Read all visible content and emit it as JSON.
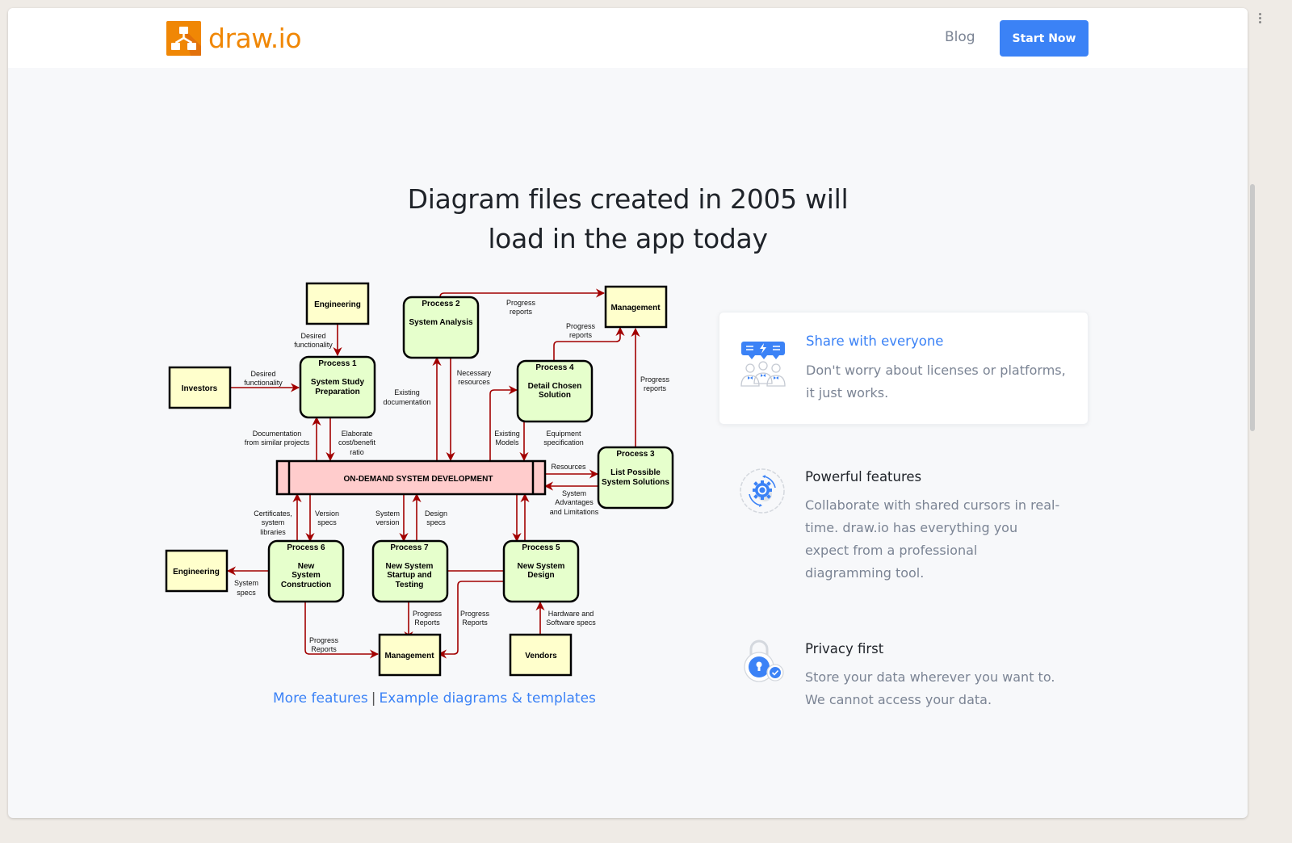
{
  "header": {
    "logo_text": "draw.io",
    "nav": {
      "blog": "Blog",
      "start_now": "Start Now"
    }
  },
  "hero": {
    "title_line1": "Diagram files created in 2005 will",
    "title_line2": "load in the app today"
  },
  "diagram": {
    "central": "ON-DEMAND SYSTEM DEVELOPMENT",
    "entities": {
      "engineering_top": "Engineering",
      "investors": "Investors",
      "management_top": "Management",
      "engineering_bottom": "Engineering",
      "management_bottom": "Management",
      "vendors": "Vendors"
    },
    "processes": {
      "p1": {
        "label": "Process 1",
        "name1": "System Study",
        "name2": "Preparation"
      },
      "p2": {
        "label": "Process 2",
        "name1": "System Analysis"
      },
      "p3": {
        "label": "Process 3",
        "name1": "List Possible",
        "name2": "System Solutions"
      },
      "p4": {
        "label": "Process 4",
        "name1": "Detail Chosen",
        "name2": "Solution"
      },
      "p5": {
        "label": "Process 5",
        "name1": "New System",
        "name2": "Design"
      },
      "p6": {
        "label": "Process 6",
        "name1": "New",
        "name2": "System",
        "name3": "Construction"
      },
      "p7": {
        "label": "Process 7",
        "name1": "New System",
        "name2": "Startup and",
        "name3": "Testing"
      }
    },
    "flows": {
      "eng_p1": [
        "Desired",
        "functionality"
      ],
      "inv_p1": [
        "Desired",
        "functionality"
      ],
      "p2_mgmt": [
        "Progress",
        "reports"
      ],
      "p4_mgmt": [
        "Progress",
        "reports"
      ],
      "p3_mgmt": [
        "Progress",
        "reports"
      ],
      "existing_doc": [
        "Existing",
        "documentation"
      ],
      "necessary_res": [
        "Necessary",
        "resources"
      ],
      "doc_similar": [
        "Documentation",
        "from similar projects"
      ],
      "elaborate": [
        "Elaborate",
        "cost/benefit",
        "ratio"
      ],
      "existing_models": [
        "Existing",
        "Models"
      ],
      "equipment_spec": [
        "Equipment",
        "specification"
      ],
      "resources": [
        "Resources"
      ],
      "sys_adv": [
        "System",
        "Advantages",
        "and Limitations"
      ],
      "certificates": [
        "Certificates,",
        "system",
        "libraries"
      ],
      "version_specs": [
        "Version",
        "specs"
      ],
      "system_version": [
        "System",
        "version"
      ],
      "design_specs": [
        "Design",
        "specs"
      ],
      "system_specs": [
        "System",
        "specs"
      ],
      "p6_mgmt": [
        "Progress",
        "Reports"
      ],
      "p7_mgmt": [
        "Progress",
        "Reports"
      ],
      "p5_mgmt": [
        "Progress",
        "Reports"
      ],
      "hw_sw": [
        "Hardware and",
        "Software specs"
      ]
    }
  },
  "links": {
    "more_features": "More features",
    "separator": "|",
    "examples": "Example diagrams & templates"
  },
  "features": [
    {
      "title": "Share with everyone",
      "desc": "Don't worry about licenses or platforms, it just works.",
      "icon": "share-users-icon"
    },
    {
      "title": "Powerful features",
      "desc": "Collaborate with shared cursors in real-time. draw.io has everything you expect from a professional diagramming tool.",
      "icon": "gear-icon"
    },
    {
      "title": "Privacy first",
      "desc": "Store your data wherever you want to. We cannot access your data.",
      "icon": "lock-icon"
    }
  ],
  "colors": {
    "brand_orange": "#f08705",
    "accent_blue": "#3b82f6",
    "flow_red": "#a20000",
    "process_fill": "#e6ffcc",
    "entity_fill": "#ffffcc",
    "central_fill": "#ffcccc"
  }
}
